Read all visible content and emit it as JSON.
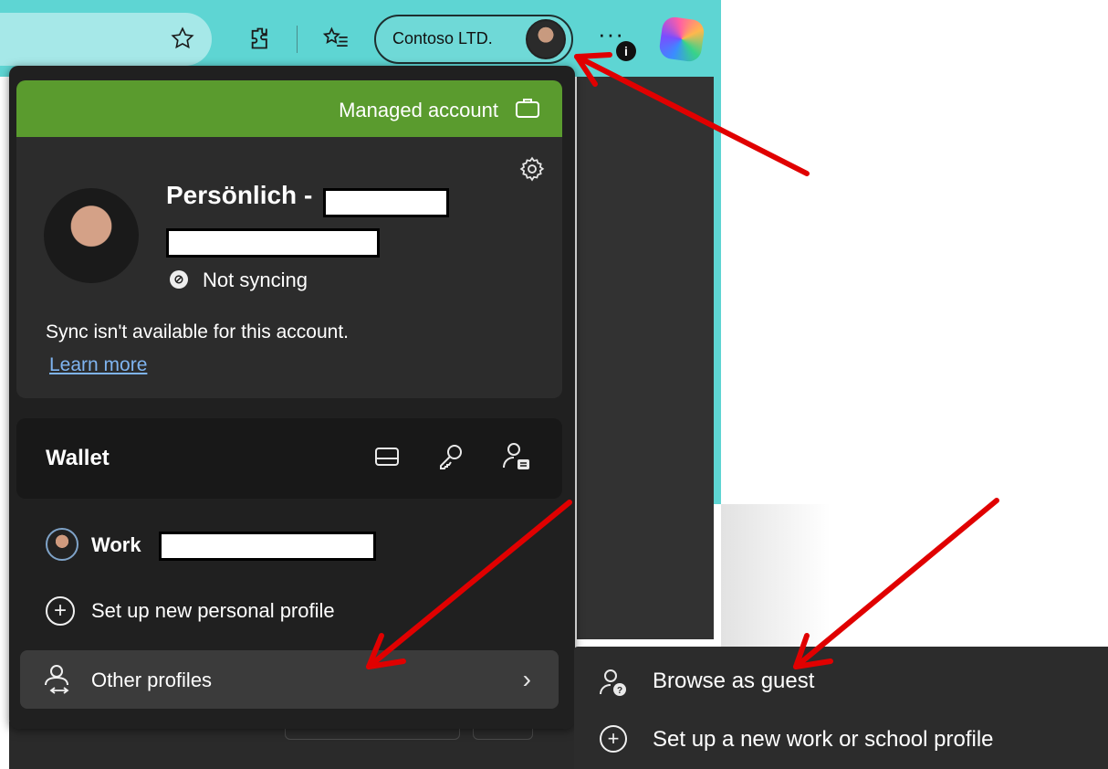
{
  "toolbar": {
    "profile_button_label": "Contoso LTD.",
    "more_menu_glyph": "···",
    "info_badge": "i",
    "icons": [
      "favorite-star-icon",
      "extensions-puzzle-icon",
      "favorites-list-icon",
      "copilot-icon"
    ]
  },
  "flyout": {
    "managed_banner": {
      "label": "Managed account",
      "icon": "briefcase-icon",
      "color": "#5a9b2e"
    },
    "profile": {
      "name": "Persönlich -",
      "sync_status": "Not syncing",
      "sync_info": "Sync isn't available for this account.",
      "learn_more": "Learn more"
    },
    "wallet": {
      "title": "Wallet",
      "icons": [
        "payment-card-icon",
        "password-key-icon",
        "personal-info-icon"
      ]
    },
    "other_profile": {
      "label": "Work"
    },
    "new_profile": {
      "label": "Set up new personal profile"
    },
    "other_profiles": {
      "label": "Other profiles",
      "chevron": "›"
    }
  },
  "submenu": {
    "items": [
      {
        "label": "Browse as guest",
        "icon": "guest-person-icon"
      },
      {
        "label": "Set up a new work or school profile",
        "icon": "plus-circle-icon"
      }
    ]
  },
  "annotations": {
    "arrow_color": "#e00000"
  }
}
